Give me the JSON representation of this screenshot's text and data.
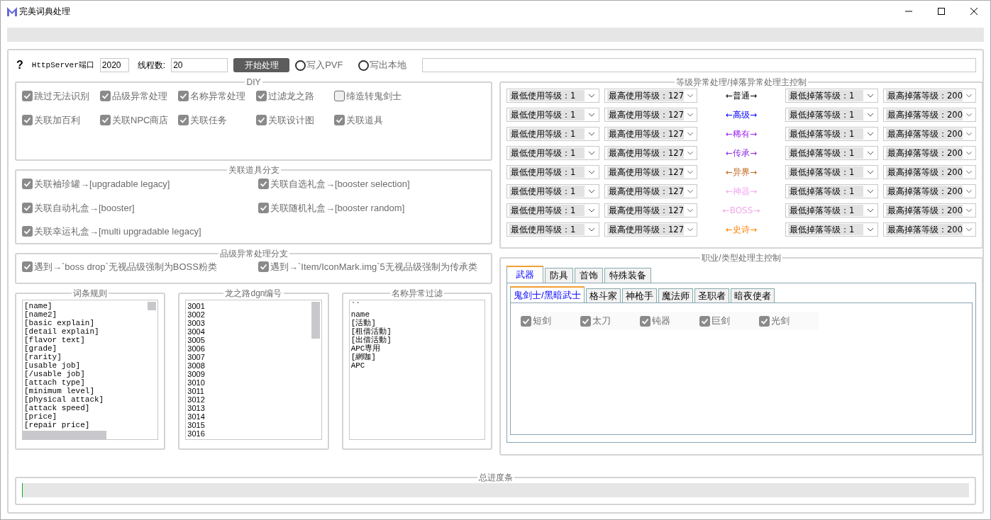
{
  "window": {
    "title": "完美词典处理"
  },
  "top_bar": {
    "help": "?",
    "port_label": "HttpServer端口",
    "port": "2020",
    "threads_label": "线程数:",
    "threads": "20",
    "start_button": "开始处理",
    "radios": [
      {
        "label": "写入PVF",
        "selected": false
      },
      {
        "label": "写出本地",
        "selected": false
      }
    ]
  },
  "diy": {
    "title": "DIY",
    "options": [
      {
        "label": "跳过无法识别",
        "checked": true
      },
      {
        "label": "品级异常处理",
        "checked": true
      },
      {
        "label": "名称异常处理",
        "checked": true
      },
      {
        "label": "过滤龙之路",
        "checked": true
      },
      {
        "label": "缔造转鬼剑士",
        "checked": false
      },
      {
        "label": "关联加百利",
        "checked": true
      },
      {
        "label": "关联NPC商店",
        "checked": true
      },
      {
        "label": "关联任务",
        "checked": true
      },
      {
        "label": "关联设计图",
        "checked": true
      },
      {
        "label": "关联道具",
        "checked": true
      }
    ]
  },
  "item_branch": {
    "title": "关联道具分支",
    "options": [
      {
        "label": "关联袖珍罐→[upgradable legacy]",
        "checked": true
      },
      {
        "label": "关联自选礼盒→[booster selection]",
        "checked": true
      },
      {
        "label": "关联自动礼盒→[booster]",
        "checked": true
      },
      {
        "label": "关联随机礼盒→[booster random]",
        "checked": true
      },
      {
        "label": "关联幸运礼盒→[multi upgradable legacy]",
        "checked": true
      }
    ]
  },
  "grade_branch": {
    "title": "品级异常处理分支",
    "options": [
      {
        "label": "遇到→`boss drop`无视品级强制为BOSS粉类",
        "checked": true
      },
      {
        "label": "遇到→`Item/IconMark.img`5无视品级强制为传承类",
        "checked": true
      }
    ]
  },
  "lists": [
    {
      "title": "词条规则",
      "mono": true,
      "lines": [
        "[name]",
        "[name2]",
        "[basic explain]",
        "[detail explain]",
        "[flavor text]",
        "[grade]",
        "[rarity]",
        "[usable job]",
        "[/usable job]",
        "[attach type]",
        "[minimum level]",
        "[physical attack]",
        "[attack speed]",
        "[price]",
        "[repair price]"
      ]
    },
    {
      "title": "龙之路dgn编号",
      "mono": false,
      "lines": [
        "3001",
        "3002",
        "3003",
        "3004",
        "3005",
        "3006",
        "3007",
        "3008",
        "3009",
        "3010",
        "3011",
        "3012",
        "3013",
        "3014",
        "3015",
        "3016"
      ]
    },
    {
      "title": "名称异常过滤",
      "mono": true,
      "lines": [
        "``",
        "name",
        "[活動]",
        "[租借活動]",
        "[出借活動]",
        "APC専用",
        "[網咖]",
        "APC"
      ]
    }
  ],
  "grade_control": {
    "title": "等级异常处理/掉落异常处理主控制",
    "rows": [
      {
        "tier": "←普通→",
        "color": "#000000",
        "min_use": "最低使用等级：1",
        "max_use": "最高使用等级：127",
        "min_drop": "最低掉落等级：1",
        "max_drop": "最高掉落等级：200"
      },
      {
        "tier": "←高级→",
        "color": "#0000ff",
        "min_use": "最低使用等级：1",
        "max_use": "最高使用等级：127",
        "min_drop": "最低掉落等级：1",
        "max_drop": "最高掉落等级：200"
      },
      {
        "tier": "←稀有→",
        "color": "#a020f0",
        "min_use": "最低使用等级：1",
        "max_use": "最高使用等级：127",
        "min_drop": "最低掉落等级：1",
        "max_drop": "最高掉落等级：200"
      },
      {
        "tier": "←传承→",
        "color": "#8a2be2",
        "min_use": "最低使用等级：1",
        "max_use": "最高使用等级：127",
        "min_drop": "最低掉落等级：1",
        "max_drop": "最高掉落等级：200"
      },
      {
        "tier": "←异界→",
        "color": "#c0661a",
        "min_use": "最低使用等级：1",
        "max_use": "最高使用等级：127",
        "min_drop": "最低掉落等级：1",
        "max_drop": "最高掉落等级：200"
      },
      {
        "tier": "←神器→",
        "color": "#f4a8f4",
        "min_use": "最低使用等级：1",
        "max_use": "最高使用等级：127",
        "min_drop": "最低掉落等级：1",
        "max_drop": "最高掉落等级：200"
      },
      {
        "tier": "←BOSS→",
        "color": "#f0a8e8",
        "min_use": "最低使用等级：1",
        "max_use": "最高使用等级：127",
        "min_drop": "最低掉落等级：1",
        "max_drop": "最高掉落等级：200"
      },
      {
        "tier": "←史诗→",
        "color": "#ff8000",
        "min_use": "最低使用等级：1",
        "max_use": "最高使用等级：127",
        "min_drop": "最低掉落等级：1",
        "max_drop": "最高掉落等级：200"
      }
    ]
  },
  "job_control": {
    "title": "职业/类型处理主控制",
    "tabs": [
      {
        "label": "武器",
        "selected": true
      },
      {
        "label": "防具",
        "selected": false
      },
      {
        "label": "首饰",
        "selected": false
      },
      {
        "label": "特殊装备",
        "selected": false
      }
    ],
    "sub_tabs": [
      {
        "label": "鬼剑士/黑暗武士",
        "selected": true
      },
      {
        "label": "格斗家",
        "selected": false
      },
      {
        "label": "神枪手",
        "selected": false
      },
      {
        "label": "魔法师",
        "selected": false
      },
      {
        "label": "圣职者",
        "selected": false
      },
      {
        "label": "暗夜使者",
        "selected": false
      }
    ],
    "options": [
      {
        "label": "短剑",
        "checked": true
      },
      {
        "label": "太刀",
        "checked": true
      },
      {
        "label": "钝器",
        "checked": true
      },
      {
        "label": "巨剑",
        "checked": true
      },
      {
        "label": "光剑",
        "checked": true
      }
    ]
  },
  "progress": {
    "title": "总进度条",
    "level": 0
  }
}
